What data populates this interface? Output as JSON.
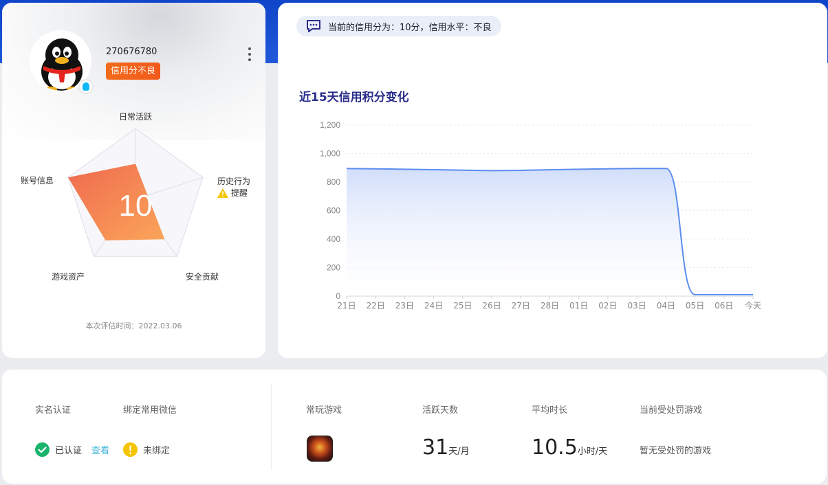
{
  "profile": {
    "qq_id": "270676780",
    "credit_tag": "信用分不良",
    "score": "10",
    "radar_labels": {
      "daily_active": "日常活跃",
      "history": "历史行为",
      "safety": "安全贡献",
      "assets": "游戏资产",
      "account": "账号信息"
    },
    "warning_text": "提醒",
    "eval_time": "本次评估时间：2022.03.06",
    "radar_values": {
      "daily_active": 0.5,
      "history": 0.18,
      "safety": 0.7,
      "assets": 0.72,
      "account": 1.0
    }
  },
  "chart_card": {
    "score_summary": "当前的信用分为：10分，信用水平：不良",
    "title": "近15天信用积分变化"
  },
  "chart_data": {
    "type": "area",
    "title": "近15天信用积分变化",
    "xlabel": "",
    "ylabel": "",
    "x": [
      "21日",
      "22日",
      "23日",
      "24日",
      "25日",
      "26日",
      "27日",
      "28日",
      "01日",
      "02日",
      "03日",
      "04日",
      "05日",
      "06日",
      "今天"
    ],
    "values": [
      895,
      893,
      890,
      887,
      883,
      880,
      882,
      886,
      890,
      893,
      895,
      895,
      10,
      10,
      10
    ],
    "ylim": [
      0,
      1200
    ],
    "yticks": [
      "0",
      "200",
      "400",
      "600",
      "800",
      "1,000",
      "1,200"
    ],
    "grid": true,
    "colors": {
      "line": "#5b8def",
      "fill": "#d7e2fb"
    }
  },
  "stats": {
    "realname_label": "实名认证",
    "realname_status": "已认证",
    "realname_view": "查看",
    "wechat_label": "绑定常用微信",
    "wechat_status": "未绑定",
    "games_label": "常玩游戏",
    "active_days_label": "活跃天数",
    "active_days_value": "31",
    "active_days_unit": "天/月",
    "avg_time_label": "平均时长",
    "avg_time_value": "10.5",
    "avg_time_unit": "小时/天",
    "penalty_label": "当前受处罚游戏",
    "penalty_text": "暂无受处罚的游戏"
  },
  "colors": {
    "brand_blue": "#1f59d8",
    "tag_orange": "#f26b1d",
    "ok_green": "#19b36b",
    "warn_yellow": "#f5c400",
    "link_cyan": "#3eb4d8",
    "title_navy": "#2a2e8a"
  },
  "icons": [
    "qq-penguin-icon",
    "qq-badge-icon",
    "more-vertical-icon",
    "warning-icon",
    "chat-message-icon",
    "check-circle-icon",
    "exclamation-circle-icon",
    "game-app-icon"
  ]
}
